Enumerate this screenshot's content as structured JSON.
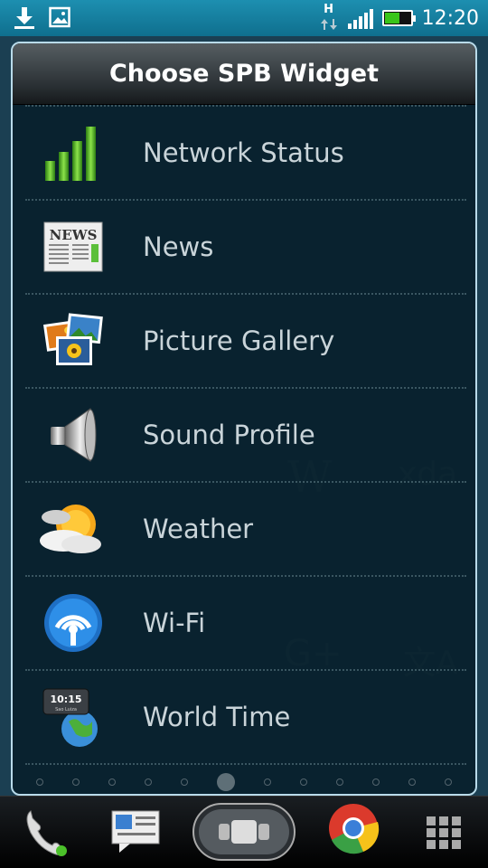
{
  "status_bar": {
    "time": "12:20",
    "network_type": "H",
    "icons": [
      "download-icon",
      "image-icon",
      "data-arrows-icon",
      "signal-icon",
      "battery-icon"
    ],
    "battery_color": "#39c51a"
  },
  "dialog": {
    "title": "Choose SPB Widget",
    "items": [
      {
        "label": "Network Status",
        "icon": "network-status-icon"
      },
      {
        "label": "News",
        "icon": "news-icon"
      },
      {
        "label": "Picture Gallery",
        "icon": "picture-gallery-icon"
      },
      {
        "label": "Sound Profile",
        "icon": "sound-profile-icon"
      },
      {
        "label": "Weather",
        "icon": "weather-icon"
      },
      {
        "label": "Wi-Fi",
        "icon": "wifi-icon"
      },
      {
        "label": "World Time",
        "icon": "world-time-icon",
        "clock_text": "10:15",
        "clock_sub": "Sao Luiza"
      }
    ]
  },
  "background": {
    "ghost_texts": [
      "W",
      "xda",
      "G+",
      "文A"
    ]
  },
  "dock": {
    "items": [
      "phone-icon",
      "messages-icon",
      "launcher-button",
      "chrome-icon",
      "all-apps-icon"
    ]
  }
}
